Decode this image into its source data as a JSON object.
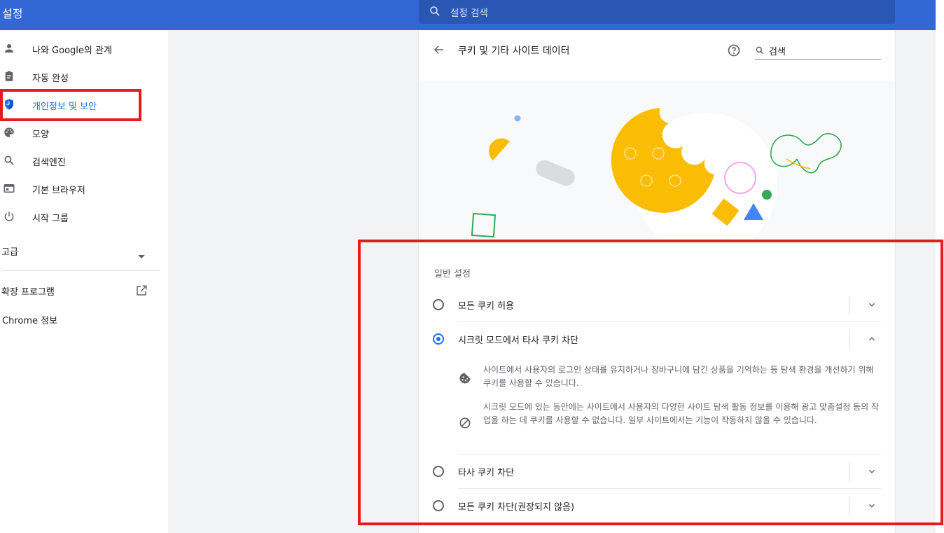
{
  "app": {
    "title": "설정",
    "search_placeholder": "설정 검색"
  },
  "sidebar": {
    "items": [
      {
        "label": "나와 Google의 관계",
        "icon": "person-icon"
      },
      {
        "label": "자동 완성",
        "icon": "clipboard-icon"
      },
      {
        "label": "개인정보 및 보안",
        "icon": "shield-icon",
        "active": true
      },
      {
        "label": "모양",
        "icon": "palette-icon"
      },
      {
        "label": "검색엔진",
        "icon": "search-icon"
      },
      {
        "label": "기본 브라우저",
        "icon": "browser-icon"
      },
      {
        "label": "시작 그룹",
        "icon": "power-icon"
      }
    ],
    "advanced": "고급",
    "extensions": "확장 프로그램",
    "about": "Chrome 정보"
  },
  "page": {
    "title": "쿠키 및 기타 사이트 데이터",
    "search_value": "검색",
    "section_label": "일반 설정",
    "options": [
      {
        "label": "모든 쿠키 허용",
        "checked": false,
        "expanded": false
      },
      {
        "label": "시크릿 모드에서 타사 쿠키 차단",
        "checked": true,
        "expanded": true
      },
      {
        "label": "타사 쿠키 차단",
        "checked": false,
        "expanded": false
      },
      {
        "label": "모든 쿠키 차단(권장되지 않음)",
        "checked": false,
        "expanded": false
      }
    ],
    "details": [
      {
        "icon": "cookie-icon",
        "text": "사이트에서 사용자의 로그인 상태를 유지하거나 장바구니에 담긴 상품을 기억하는 등 탐색 환경을 개선하기 위해 쿠키를 사용할 수 있습니다."
      },
      {
        "icon": "block-icon",
        "text": "시크릿 모드에 있는 동안에는 사이트에서 사용자의 다양한 사이트 탐색 활동 정보를 이용해 광고 맞춤설정 등의 작업을 하는 데 쿠키를 사용할 수 없습니다. 일부 사이트에서는 기능이 작동하지 않을 수 있습니다."
      }
    ]
  },
  "colors": {
    "header": "#3367d6",
    "accent": "#1a73e8",
    "highlight": "#e51c1c"
  }
}
